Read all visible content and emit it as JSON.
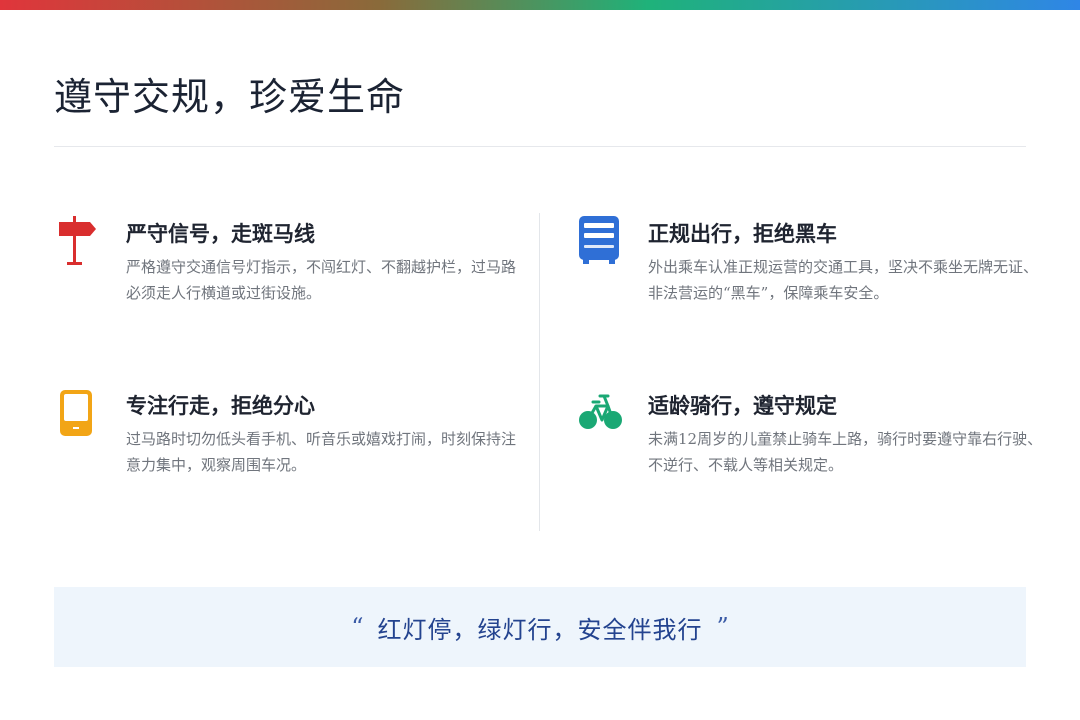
{
  "colors": {
    "accent_red": "#d92e2e",
    "accent_blue": "#2f6fd6",
    "accent_amber": "#f2a516",
    "accent_green": "#1aa874"
  },
  "header": {
    "title": "遵守交规，珍爱生命"
  },
  "items": [
    {
      "title": "严守信号，走斑马线",
      "desc": "严格遵守交通信号灯指示，不闯红灯、不翻越护栏，过马路必须走人行横道或过街设施。",
      "icon": "signpost-icon"
    },
    {
      "title": "正规出行，拒绝黑车",
      "desc": "外出乘车认准正规运营的交通工具，坚决不乘坐无牌无证、非法营运的“黑车”，保障乘车安全。",
      "icon": "bus-icon"
    },
    {
      "title": "专注行走，拒绝分心",
      "desc": "过马路时切勿低头看手机、听音乐或嬉戏打闹，时刻保持注意力集中，观察周围车况。",
      "icon": "phone-icon"
    },
    {
      "title": "适龄骑行，遵守规定",
      "desc": "未满12周岁的儿童禁止骑车上路，骑行时要遵守靠右行驶、不逆行、不载人等相关规定。",
      "icon": "bicycle-icon"
    }
  ],
  "quote": {
    "open_mark": "“",
    "text": "红灯停，绿灯行，安全伴我行",
    "close_mark": "”"
  }
}
